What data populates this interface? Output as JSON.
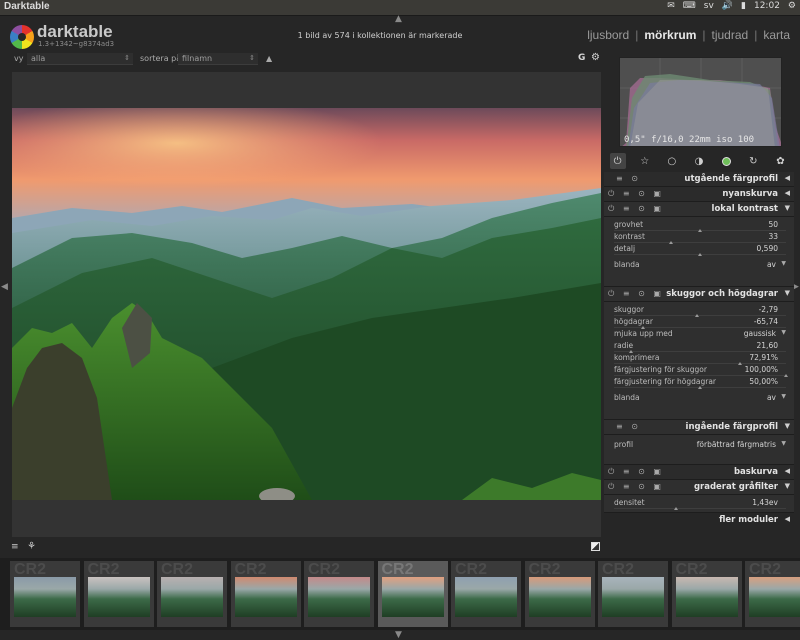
{
  "window": {
    "title": "Darktable"
  },
  "tray": {
    "lang": "sv",
    "time": "12:02"
  },
  "header": {
    "app_name": "darktable",
    "app_version": "1.3+1342~g8374ad3",
    "selection_info": "1 bild av 574 i kollektionen är markerade",
    "views": [
      {
        "label": "ljusbord",
        "active": false
      },
      {
        "label": "mörkrum",
        "active": true
      },
      {
        "label": "tjudrad",
        "active": false
      },
      {
        "label": "karta",
        "active": false
      }
    ],
    "view_separator": "|"
  },
  "filterbar": {
    "view_label": "vy",
    "view_value": "alla",
    "sort_label": "sortera på",
    "sort_value": "filnamn",
    "sort_dir": "▲",
    "grouping": "G"
  },
  "histogram": {
    "exif": "0,5\" f/16,0 22mm iso 100"
  },
  "module_groups": [
    "power",
    "star",
    "circle",
    "half-circle",
    "color-circle",
    "refresh",
    "palette"
  ],
  "modules": {
    "m1": {
      "name": "utgående färgprofil"
    },
    "m2": {
      "name": "nyanskurva"
    },
    "m3": {
      "name": "lokal kontrast",
      "params": [
        {
          "label": "grovhet",
          "value": "50",
          "pos": 0.5
        },
        {
          "label": "kontrast",
          "value": "33",
          "pos": 0.33
        },
        {
          "label": "detalj",
          "value": "0,590",
          "pos": 0.5
        }
      ],
      "blend_label": "blanda",
      "blend_value": "av"
    },
    "m4": {
      "name": "skuggor och högdagrar",
      "params": [
        {
          "label": "skuggor",
          "value": "-2,79",
          "pos": 0.48
        },
        {
          "label": "högdagrar",
          "value": "-65,74",
          "pos": 0.17
        },
        {
          "label": "radie",
          "value": "21,60",
          "pos": 0.1
        },
        {
          "label": "komprimera",
          "value": "72,91%",
          "pos": 0.73
        },
        {
          "label": "färgjustering för skuggor",
          "value": "100,00%",
          "pos": 1.0
        },
        {
          "label": "färgjustering för högdagrar",
          "value": "50,00%",
          "pos": 0.5
        }
      ],
      "soften_label": "mjuka upp med",
      "soften_value": "gaussisk",
      "blend_label": "blanda",
      "blend_value": "av"
    },
    "m5": {
      "name": "ingående färgprofil",
      "profile_label": "profil",
      "profile_value": "förbättrad färgmatris"
    },
    "m6": {
      "name": "baskurva"
    },
    "m7": {
      "name": "graderat gråfilter",
      "density_label": "densitet",
      "density_value": "1,43ev",
      "pos": 0.36
    },
    "more": "fler moduler"
  },
  "filmstrip": {
    "ext": "CR2",
    "count": 11,
    "active_index": 5
  },
  "colors": {
    "background": "#262626",
    "panel": "#2f2f2f",
    "text": "#bdbdbd",
    "highlight": "#e8e8e8"
  }
}
